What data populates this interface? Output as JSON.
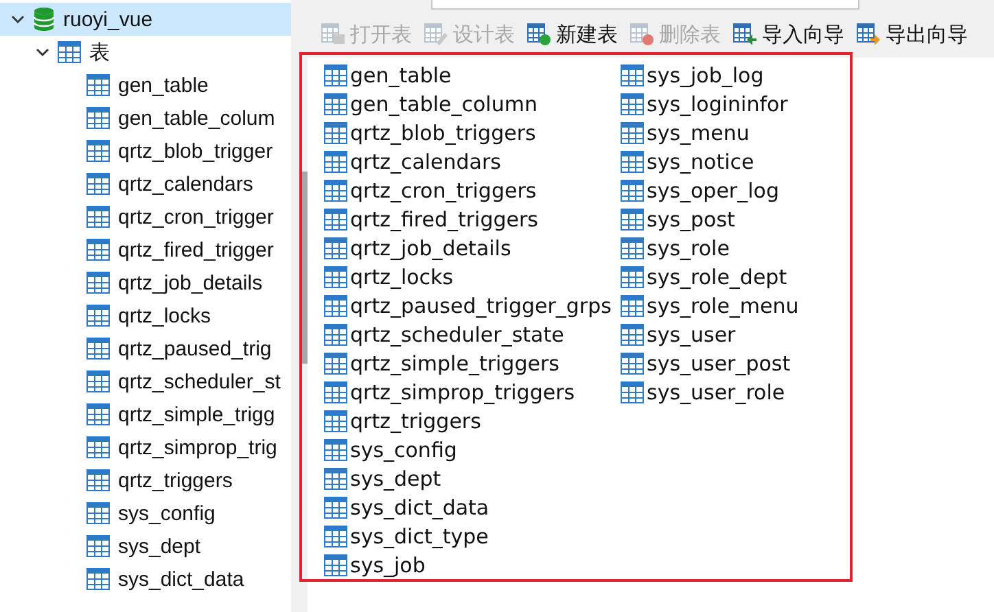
{
  "tree": {
    "database": {
      "label": "ruoyi_vue",
      "expanded": true,
      "selected": true
    },
    "group": {
      "label": "表",
      "expanded": true
    },
    "tables": [
      "gen_table",
      "gen_table_colum",
      "qrtz_blob_trigger",
      "qrtz_calendars",
      "qrtz_cron_trigger",
      "qrtz_fired_trigger",
      "qrtz_job_details",
      "qrtz_locks",
      "qrtz_paused_trig",
      "qrtz_scheduler_st",
      "qrtz_simple_trigg",
      "qrtz_simprop_trig",
      "qrtz_triggers",
      "sys_config",
      "sys_dept",
      "sys_dict_data"
    ]
  },
  "toolbar": [
    {
      "label": "打开表",
      "kind": "open",
      "disabled": true
    },
    {
      "label": "设计表",
      "kind": "design",
      "disabled": true
    },
    {
      "label": "新建表",
      "kind": "new",
      "disabled": false
    },
    {
      "label": "删除表",
      "kind": "delete",
      "disabled": true
    },
    {
      "label": "导入向导",
      "kind": "import",
      "disabled": false
    },
    {
      "label": "导出向导",
      "kind": "export",
      "disabled": false
    }
  ],
  "objects": [
    "gen_table",
    "gen_table_column",
    "qrtz_blob_triggers",
    "qrtz_calendars",
    "qrtz_cron_triggers",
    "qrtz_fired_triggers",
    "qrtz_job_details",
    "qrtz_locks",
    "qrtz_paused_trigger_grps",
    "qrtz_scheduler_state",
    "qrtz_simple_triggers",
    "qrtz_simprop_triggers",
    "qrtz_triggers",
    "sys_config",
    "sys_dept",
    "sys_dict_data",
    "sys_dict_type",
    "sys_job",
    "sys_job_log",
    "sys_logininfor",
    "sys_menu",
    "sys_notice",
    "sys_oper_log",
    "sys_post",
    "sys_role",
    "sys_role_dept",
    "sys_role_menu",
    "sys_user",
    "sys_user_post",
    "sys_user_role"
  ],
  "annotation": {
    "kind": "frame",
    "color": "#e8202a"
  }
}
